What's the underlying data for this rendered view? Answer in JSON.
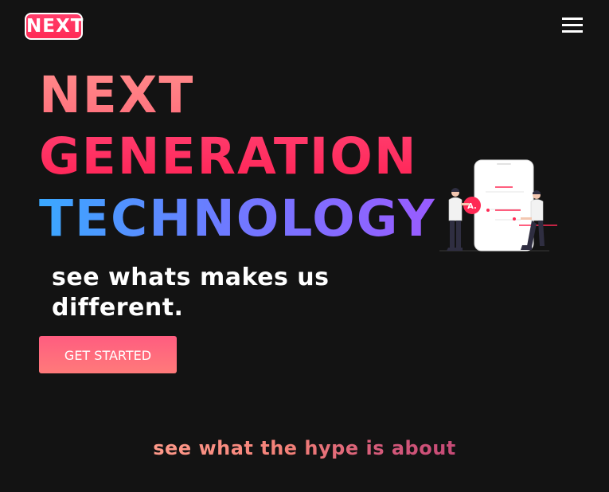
{
  "header": {
    "logo_text": "NEXT",
    "menu_icon": "hamburger-menu-icon"
  },
  "hero": {
    "line1": "NEXT",
    "line2": "GENERATION",
    "line3": "TECHNOLOGY",
    "tagline": "see whats makes us different.",
    "cta_label": "GET STARTED",
    "illustration": "team-with-phone-illustration",
    "illustration_badge": "A."
  },
  "section": {
    "heading": "see what the hype is about"
  },
  "colors": {
    "background": "#131313",
    "accent_pink": "#ff2a55",
    "accent_salmon": "#ff7a7a",
    "accent_blue": "#3aa8ff",
    "accent_purple": "#9a5bff"
  }
}
